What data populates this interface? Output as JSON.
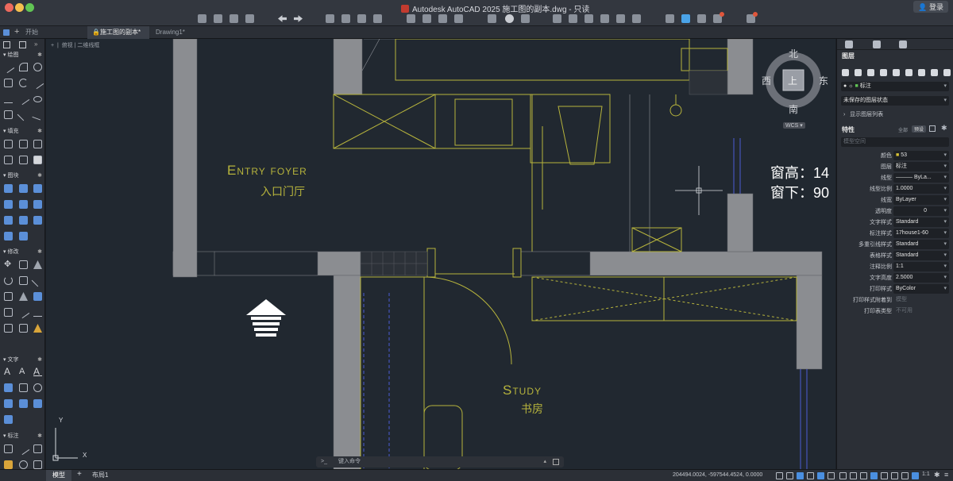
{
  "window": {
    "title": "Autodesk AutoCAD 2025   施工图的副本.dwg - 只读",
    "login_label": "登录"
  },
  "tabs": {
    "start": "开始",
    "file_tab": "施工图的副本*",
    "drawing_tab": "Drawing1*"
  },
  "viewport": {
    "view_label": "俯视",
    "style_label": "二维线框"
  },
  "tool_palette": {
    "sections": [
      "绘图",
      "填充",
      "图块",
      "修改",
      "文字",
      "标注"
    ]
  },
  "viewcube": {
    "north": "北",
    "south": "南",
    "east": "东",
    "west": "西",
    "face": "上",
    "wcs": "WCS"
  },
  "drawing": {
    "entry_en": "Entry foyer",
    "entry_cn": "入口门厅",
    "study_en": "Study",
    "study_cn": "书房",
    "window_height": "窗高：14",
    "window_sill": "窗下：90"
  },
  "layers_panel": {
    "title": "图层",
    "current_layer": "标注",
    "layer_state": "未保存的图层状态",
    "show_list": "显示图层列表"
  },
  "properties": {
    "title": "特性",
    "all_label": "全部",
    "filter_label": "预设",
    "space": "模型空间",
    "rows": [
      {
        "key": "颜色",
        "value": "53"
      },
      {
        "key": "图层",
        "value": "标注"
      },
      {
        "key": "线型",
        "value": "——— ByLa..."
      },
      {
        "key": "线型比例",
        "value": "1.0000"
      },
      {
        "key": "线宽",
        "value": "ByLayer"
      },
      {
        "key": "透明度",
        "value": "0"
      },
      {
        "key": "文字样式",
        "value": "Standard"
      },
      {
        "key": "标注样式",
        "value": "17house1-60"
      },
      {
        "key": "多重引线样式",
        "value": "Standard"
      },
      {
        "key": "表格样式",
        "value": "Standard"
      },
      {
        "key": "注释比例",
        "value": "1:1"
      },
      {
        "key": "文字高度",
        "value": "2.5000"
      },
      {
        "key": "打印样式",
        "value": "ByColor"
      },
      {
        "key": "打印样式附着到",
        "value": "模型"
      },
      {
        "key": "打印表类型",
        "value": "不可用"
      }
    ]
  },
  "command_line": {
    "prompt": ">_",
    "placeholder": "键入命令"
  },
  "status_bar": {
    "model_tab": "模型",
    "layout_tab": "布局1",
    "coordinates": "204494.0024, -597544.4524, 0.0000"
  },
  "colors": {
    "wall_fill": "#8b8d91",
    "annotation": "#b6b33c",
    "background": "#212830",
    "hatch_blue": "#4c5bd4"
  }
}
